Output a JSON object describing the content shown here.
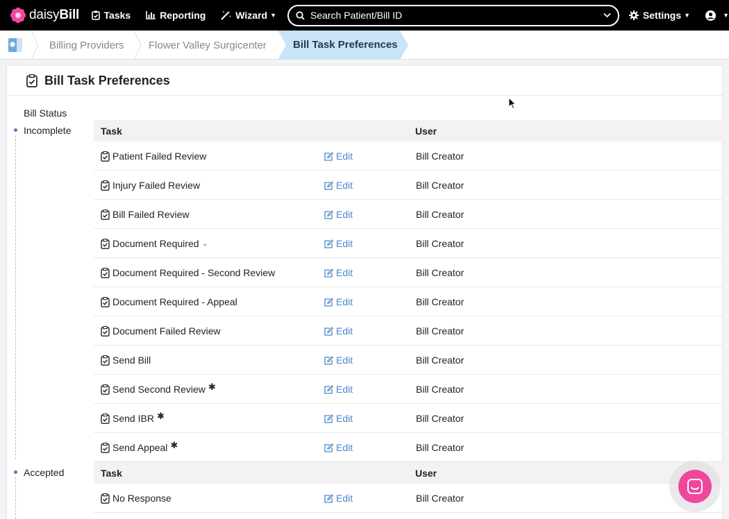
{
  "brand": {
    "light": "daisy",
    "bold": "Bill"
  },
  "nav": {
    "tasks": "Tasks",
    "reporting": "Reporting",
    "wizard": "Wizard",
    "search_placeholder": "Search Patient/Bill ID",
    "settings": "Settings"
  },
  "breadcrumb": [
    "Billing Providers",
    "Flower Valley Surgicenter",
    "Bill Task Preferences"
  ],
  "page": {
    "title": "Bill Task Preferences",
    "status_label": "Bill Status",
    "headers": {
      "task": "Task",
      "user": "User"
    },
    "edit_label": "Edit"
  },
  "groups": [
    {
      "status": "Incomplete",
      "rows": [
        {
          "task": "Patient Failed Review",
          "user": "Bill Creator"
        },
        {
          "task": "Injury Failed Review",
          "user": "Bill Creator"
        },
        {
          "task": "Bill Failed Review",
          "user": "Bill Creator"
        },
        {
          "task": "Document Required",
          "user": "Bill Creator",
          "caret": true
        },
        {
          "task": "Document Required - Second Review",
          "user": "Bill Creator"
        },
        {
          "task": "Document Required - Appeal",
          "user": "Bill Creator"
        },
        {
          "task": "Document Failed Review",
          "user": "Bill Creator"
        },
        {
          "task": "Send Bill",
          "user": "Bill Creator"
        },
        {
          "task": "Send Second Review",
          "user": "Bill Creator",
          "star": true
        },
        {
          "task": "Send IBR",
          "user": "Bill Creator",
          "star": true
        },
        {
          "task": "Send Appeal",
          "user": "Bill Creator",
          "star": true
        }
      ]
    },
    {
      "status": "Accepted",
      "rows": [
        {
          "task": "No Response",
          "user": "Bill Creator"
        }
      ]
    }
  ],
  "colors": {
    "accent": "#4a86c8",
    "brand_pink": "#f0479d",
    "active_crumb": "#c9e3f7"
  }
}
